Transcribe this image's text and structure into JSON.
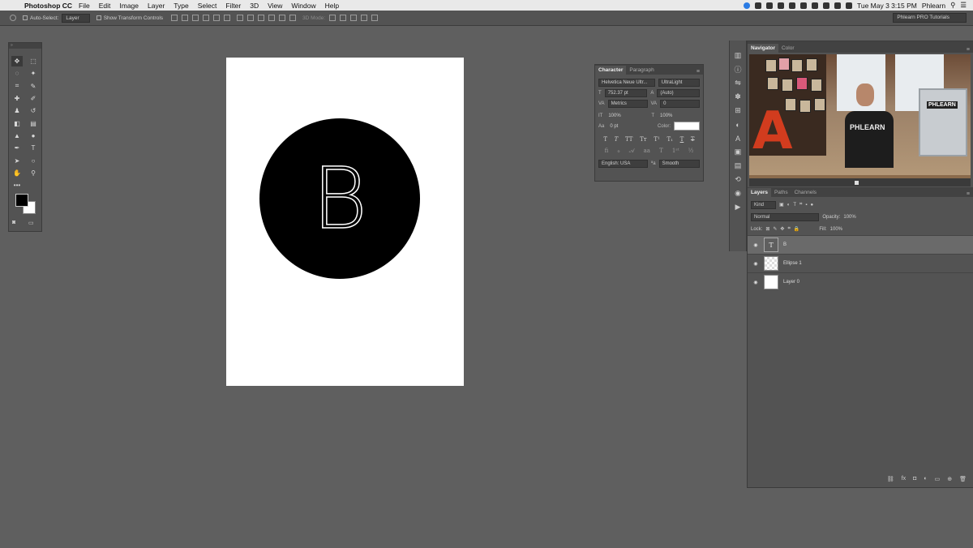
{
  "menubar": {
    "app_name": "Photoshop CC",
    "items": [
      "File",
      "Edit",
      "Image",
      "Layer",
      "Type",
      "Select",
      "Filter",
      "3D",
      "View",
      "Window",
      "Help"
    ],
    "clock": "Tue May 3  3:15 PM",
    "user": "Phlearn"
  },
  "options": {
    "auto_select_label": "Auto-Select:",
    "auto_select_value": "Layer",
    "transform_label": "Show Transform Controls",
    "mode_label": "3D Mode:",
    "workspace": "Phlearn PRO Tutorials"
  },
  "document": {
    "letter": "B"
  },
  "character": {
    "tabs": [
      "Character",
      "Paragraph"
    ],
    "font_family": "Helvetica Neue Ultr...",
    "font_style": "UltraLight",
    "font_size": "752.37 pt",
    "leading": "(Auto)",
    "kerning": "Metrics",
    "tracking": "0",
    "vertical_scale": "100%",
    "horizontal_scale": "100%",
    "baseline_shift": "0 pt",
    "color_label": "Color:",
    "language": "English: USA",
    "antialias": "Smooth"
  },
  "navigator": {
    "tabs": [
      "Navigator",
      "Color"
    ],
    "shirt_text": "PHLEARN",
    "monitor_text": "PHLEARN"
  },
  "layers": {
    "tabs": [
      "Layers",
      "Paths",
      "Channels"
    ],
    "filter": "Kind",
    "blend_mode": "Normal",
    "opacity_label": "Opacity:",
    "opacity": "100%",
    "lock_label": "Lock:",
    "fill_label": "Fill:",
    "fill": "100%",
    "items": [
      {
        "name": "B",
        "thumb": "T"
      },
      {
        "name": "Ellipse 1",
        "thumb": ""
      },
      {
        "name": "Layer 0",
        "thumb": ""
      }
    ]
  }
}
